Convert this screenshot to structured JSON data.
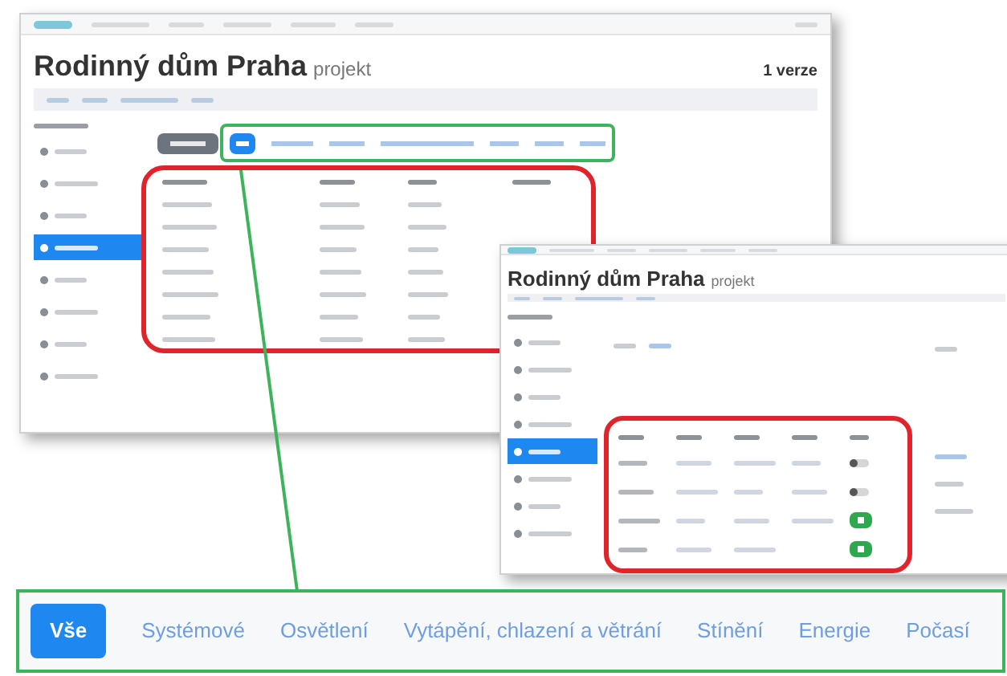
{
  "main_screenshot": {
    "title": "Rodinný dům Praha",
    "subtitle": "projekt",
    "version": "1 verze",
    "sidebar": [
      {
        "selected": false
      },
      {
        "selected": false
      },
      {
        "selected": false
      },
      {
        "selected": true
      },
      {
        "selected": false
      },
      {
        "selected": false
      },
      {
        "selected": false
      },
      {
        "selected": false
      }
    ],
    "filter_tabs": [
      {
        "selected": true
      },
      {
        "selected": false
      },
      {
        "selected": false
      },
      {
        "selected": false
      },
      {
        "selected": false
      },
      {
        "selected": false
      },
      {
        "selected": false
      }
    ]
  },
  "detail_screenshot": {
    "title": "Rodinný dům Praha",
    "subtitle": "projekt",
    "sidebar": [
      {
        "selected": false
      },
      {
        "selected": false
      },
      {
        "selected": false
      },
      {
        "selected": false
      },
      {
        "selected": true
      },
      {
        "selected": false
      },
      {
        "selected": false
      },
      {
        "selected": false
      }
    ],
    "rows": [
      {
        "active": false
      },
      {
        "active": false
      },
      {
        "active": true
      },
      {
        "active": true
      }
    ]
  },
  "callout": {
    "tabs": [
      {
        "label": "Vše",
        "selected": true
      },
      {
        "label": "Systémové",
        "selected": false
      },
      {
        "label": "Osvětlení",
        "selected": false
      },
      {
        "label": "Vytápění, chlazení a větrání",
        "selected": false
      },
      {
        "label": "Stínění",
        "selected": false
      },
      {
        "label": "Energie",
        "selected": false
      },
      {
        "label": "Počasí",
        "selected": false
      }
    ]
  }
}
